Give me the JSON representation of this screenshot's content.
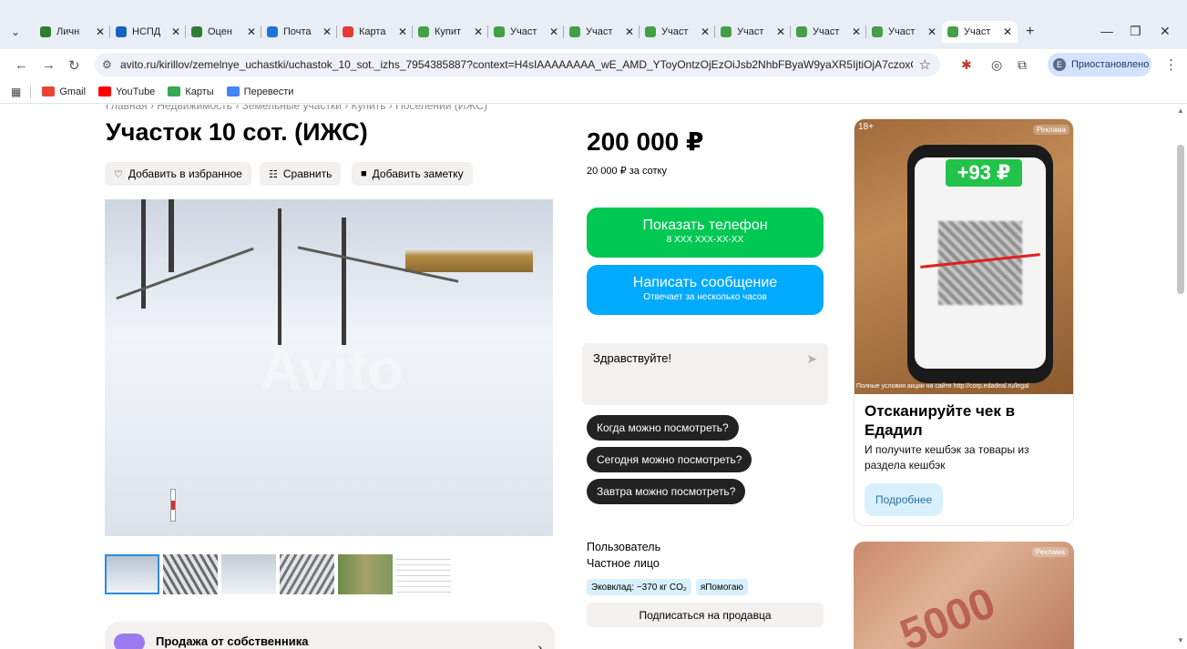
{
  "browser": {
    "tabs": [
      {
        "label": "Личн",
        "color": "#2e7d32"
      },
      {
        "label": "НСПД",
        "color": "#1565c0"
      },
      {
        "label": "Оцен",
        "color": "#2e7d32"
      },
      {
        "label": "Почта",
        "color": "#1976d2"
      },
      {
        "label": "Карта",
        "color": "#e53935"
      },
      {
        "label": "Купит",
        "color": "#43a047"
      },
      {
        "label": "Участ",
        "color": "#43a047"
      },
      {
        "label": "Участ",
        "color": "#43a047"
      },
      {
        "label": "Участ",
        "color": "#43a047"
      },
      {
        "label": "Участ",
        "color": "#43a047"
      },
      {
        "label": "Участ",
        "color": "#43a047"
      },
      {
        "label": "Участ",
        "color": "#43a047"
      },
      {
        "label": "Участ",
        "color": "#43a047"
      }
    ],
    "url": "avito.ru/kirillov/zemelnye_uchastki/uchastok_10_sot._izhs_7954385887?context=H4sIAAAAAAAA_wE_AMD_YToyOntzOjEzOiJsb2NhbFByaW9yaXR5IjtiOjA7czoxOiJ4IjtzOjE2OiJ...",
    "profile_status": "Приостановлено",
    "profile_initial": "E",
    "bookmarks": [
      {
        "label": "Gmail",
        "color": "#ea4335"
      },
      {
        "label": "YouTube",
        "color": "#ff0000"
      },
      {
        "label": "Карты",
        "color": "#34a853"
      },
      {
        "label": "Перевести",
        "color": "#4285f4"
      }
    ]
  },
  "listing": {
    "breadcrumb": "Главная › Недвижимость › Земельные участки › Купить › Поселений (ИЖС)",
    "title": "Участок 10 сот. (ИЖС)",
    "actions": {
      "favorite": "Добавить в избранное",
      "compare": "Сравнить",
      "note": "Добавить заметку"
    },
    "watermark": "Avito",
    "seller_card_title": "Продажа от собственника"
  },
  "sidebar": {
    "price": "200 000 ₽",
    "price_per": "20 000 ₽ за сотку",
    "phone_button": {
      "label": "Показать телефон",
      "sub": "8 XXX XXX-XX-XX"
    },
    "message_button": {
      "label": "Написать сообщение",
      "sub": "Отвечает за несколько часов"
    },
    "chat_text": "Здравствуйте!",
    "quick_questions": [
      "Когда можно посмотреть?",
      "Сегодня можно посмотреть?",
      "Завтра можно посмотреть?"
    ],
    "user_line1": "Пользователь",
    "user_line2": "Частное лицо",
    "tags": [
      "Эковклад: −370 кг CO₂",
      "яПомогаю"
    ],
    "subscribe": "Подписаться на продавца"
  },
  "ad": {
    "age": "18+",
    "label": "Реклама",
    "cashback": "+93 ₽",
    "fine_print": "Полные условия акции на сайте http://corp.edadeal.ru/legal",
    "title": "Отсканируйте чек в Едадил",
    "text": "И получите кешбэк за товары из раздела кешбэк",
    "button": "Подробнее",
    "label2": "Реклама",
    "money_text": "5000"
  }
}
